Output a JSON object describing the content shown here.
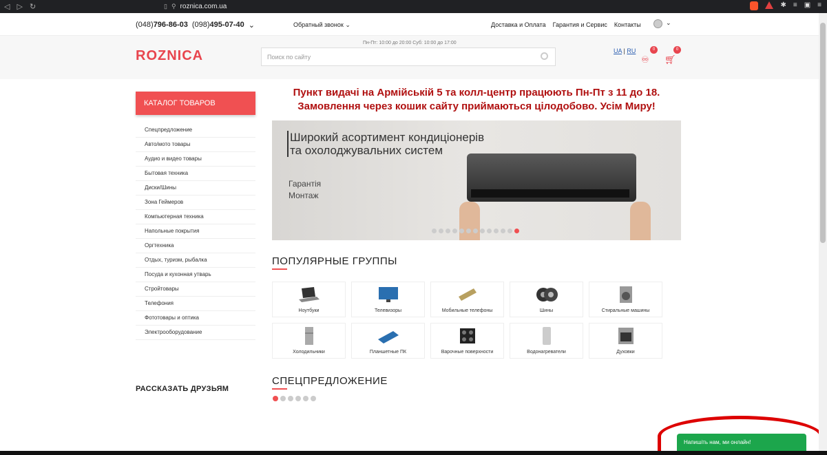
{
  "browser": {
    "url": "roznica.com.ua"
  },
  "topbar": {
    "phone1_code": "(048)",
    "phone1_num": "796-86-03",
    "phone2_code": "(098)",
    "phone2_num": "495-07-40",
    "feedback": "Обратный звонок",
    "links": [
      "Доставка и Оплата",
      "Гарантия и Сервис",
      "Контакты"
    ]
  },
  "header": {
    "logo": "ROZNICA",
    "hours": "Пн-Пт: 10:00 до 20:00 Суб: 10:00 до 17:00",
    "search_placeholder": "Поиск по сайту",
    "lang_ua": "UA",
    "lang_sep": "|",
    "lang_ru": "RU",
    "compare_count": "0",
    "cart_count": "0"
  },
  "catalog": {
    "button": "КАТАЛОГ ТОВАРОВ",
    "items": [
      "Спецпредложение",
      "Авто/мото товары",
      "Аудио и видео товары",
      "Бытовая техника",
      "Диски/Шины",
      "Зона Геймеров",
      "Компьютерная техника",
      "Напольные покрытия",
      "Оргтехника",
      "Отдых, туризм, рыбалка",
      "Посуда и кухонная утварь",
      "Стройтовары",
      "Телефония",
      "Фототовары и оптика",
      "Электрооборудование"
    ]
  },
  "announcement": {
    "line1": "Пункт видачі на Армійській 5 та колл-центр працюють Пн-Пт з 11 до 18.",
    "line2": "Замовлення через кошик сайту приймаються цілодобово. Усім Миру!"
  },
  "slider": {
    "headline1": "Широкий асортимент кондиціонерів",
    "headline2": "та охолоджувальних систем",
    "sub1": "Гарантія",
    "sub2": "Монтаж"
  },
  "popular": {
    "title": "ПОПУЛЯРНЫЕ ГРУППЫ",
    "groups": [
      "Ноутбуки",
      "Телевизоры",
      "Мобильные телефоны",
      "Шины",
      "Стиральные машины",
      "Холодильники",
      "Планшетные ПК",
      "Варочные поверхности",
      "Водонагреватели",
      "Духовки"
    ]
  },
  "special": {
    "title": "СПЕЦПРЕДЛОЖЕНИЕ"
  },
  "share": {
    "title": "РАССКАЗАТЬ ДРУЗЬЯМ"
  },
  "chat": {
    "label": "Напишіть нам, ми онлайн!"
  },
  "colors": {
    "accent": "#f05052",
    "announcement": "#b01010",
    "chat": "#1ca64c"
  }
}
